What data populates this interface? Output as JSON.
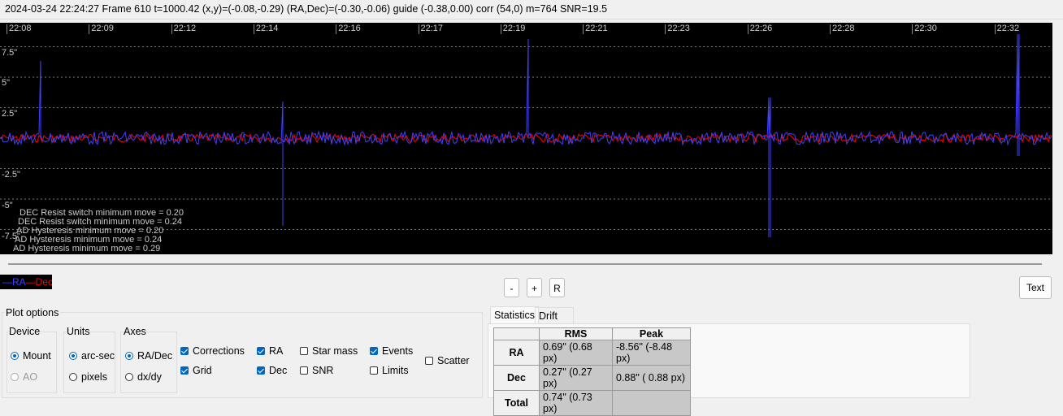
{
  "status_bar": "2024-03-24 22:24:27 Frame 610 t=1000.42 (x,y)=(-0.08,-0.29) (RA,Dec)=(-0.30,-0.06) guide (-0.38,0.00) corr (54,0) m=764 SNR=19.5",
  "graph": {
    "time_labels": [
      "22:08",
      "22:09",
      "22:12",
      "22:14",
      "22:16",
      "22:17",
      "22:19",
      "22:21",
      "22:23",
      "22:26",
      "22:28",
      "22:30",
      "22:32"
    ],
    "y_labels": [
      "7.5\"",
      "5\"",
      "2.5\"",
      "-2.5\"",
      "-5\"",
      "-7.5\""
    ],
    "notes": [
      "DEC Resist switch minimum move = 0.20",
      "DEC Resist switch minimum move = 0.24",
      "AD Hysteresis minimum move = 0.20",
      "AD Hysteresis minimum move = 0.24",
      "AD Hysteresis minimum move = 0.29"
    ],
    "ra_color": "#4040ff",
    "dec_color": "#ff0000"
  },
  "legend": {
    "ra": "—RA",
    "dec": "—Dec"
  },
  "buttons": {
    "minus": "-",
    "plus": "+",
    "reset": "R",
    "text": "Text"
  },
  "plot_options": {
    "title": "Plot options",
    "device": {
      "title": "Device",
      "mount": "Mount",
      "ao": "AO"
    },
    "units": {
      "title": "Units",
      "arcsec": "arc-sec",
      "pixels": "pixels"
    },
    "axes": {
      "title": "Axes",
      "radec": "RA/Dec",
      "dxdy": "dx/dy"
    },
    "checks": {
      "corrections": "Corrections",
      "grid": "Grid",
      "ra": "RA",
      "dec": "Dec",
      "star_mass": "Star mass",
      "snr": "SNR",
      "events": "Events",
      "limits": "Limits",
      "scatter": "Scatter"
    }
  },
  "tabs": {
    "statistics": "Statistics",
    "drift": "Drift"
  },
  "stats": {
    "headers": [
      "RMS",
      "Peak"
    ],
    "rows": [
      {
        "label": "RA",
        "rms": "0.69\" (0.68 px)",
        "peak": "-8.56\" (-8.48 px)"
      },
      {
        "label": "Dec",
        "rms": "0.27\" (0.27 px)",
        "peak": "0.88\" ( 0.88 px)"
      },
      {
        "label": "Total",
        "rms": "0.74\" (0.73 px)",
        "peak": ""
      }
    ]
  }
}
